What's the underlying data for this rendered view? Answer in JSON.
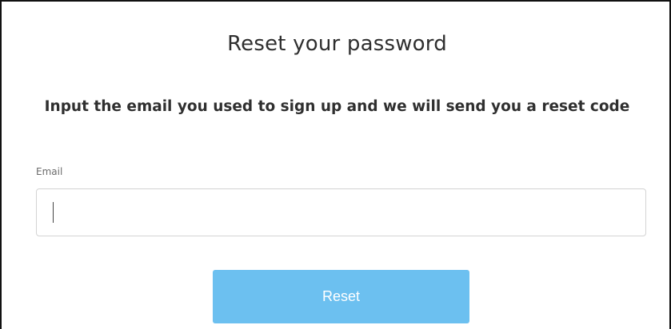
{
  "form": {
    "title": "Reset your password",
    "instructions": "Input the email you used to sign up and we will send you a reset code",
    "email_label": "Email",
    "email_value": "",
    "reset_label": "Reset"
  },
  "colors": {
    "button_background": "#6cc0f0",
    "button_text": "#ffffff",
    "field_border": "#d3d3d3",
    "heading_text": "#2f2f2f"
  }
}
